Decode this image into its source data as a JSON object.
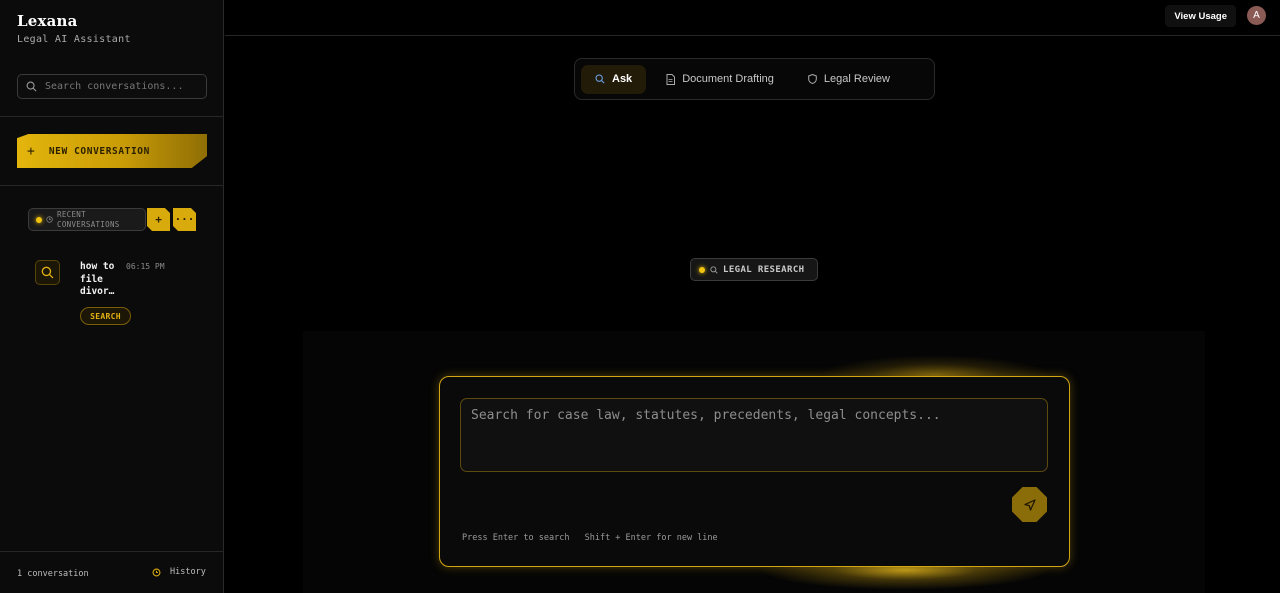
{
  "sidebar": {
    "brand": {
      "name": "Lexana",
      "subtitle": "Legal AI Assistant"
    },
    "search": {
      "placeholder": "Search conversations..."
    },
    "new_conversation": {
      "icon": "plus-icon",
      "label": "NEW CONVERSATION"
    },
    "recent": {
      "label": "RECENT CONVERSATIONS",
      "add": "+",
      "more": "···"
    },
    "conversations": [
      {
        "title": "how to file divor…",
        "time": "06:15 PM",
        "badge": "SEARCH",
        "icon": "search-icon"
      }
    ],
    "footer": {
      "count": "1 conversation",
      "history": "History"
    }
  },
  "topbar": {
    "view_usage": "View Usage",
    "avatar": "A"
  },
  "tabs": [
    {
      "label": "Ask",
      "icon": "search-icon",
      "active": true
    },
    {
      "label": "Document Drafting",
      "icon": "document-icon",
      "active": false
    },
    {
      "label": "Legal Review",
      "icon": "shield-icon",
      "active": false
    }
  ],
  "mode_indicator": {
    "label": "LEGAL RESEARCH"
  },
  "composer": {
    "placeholder": "Search for case law, statutes, precedents, legal concepts...",
    "hint_enter": "Press Enter to search",
    "hint_shift": "Shift + Enter for new line"
  },
  "colors": {
    "accent": "#d9aa0c",
    "background": "#000000",
    "sidebar": "#0b0b0b"
  }
}
